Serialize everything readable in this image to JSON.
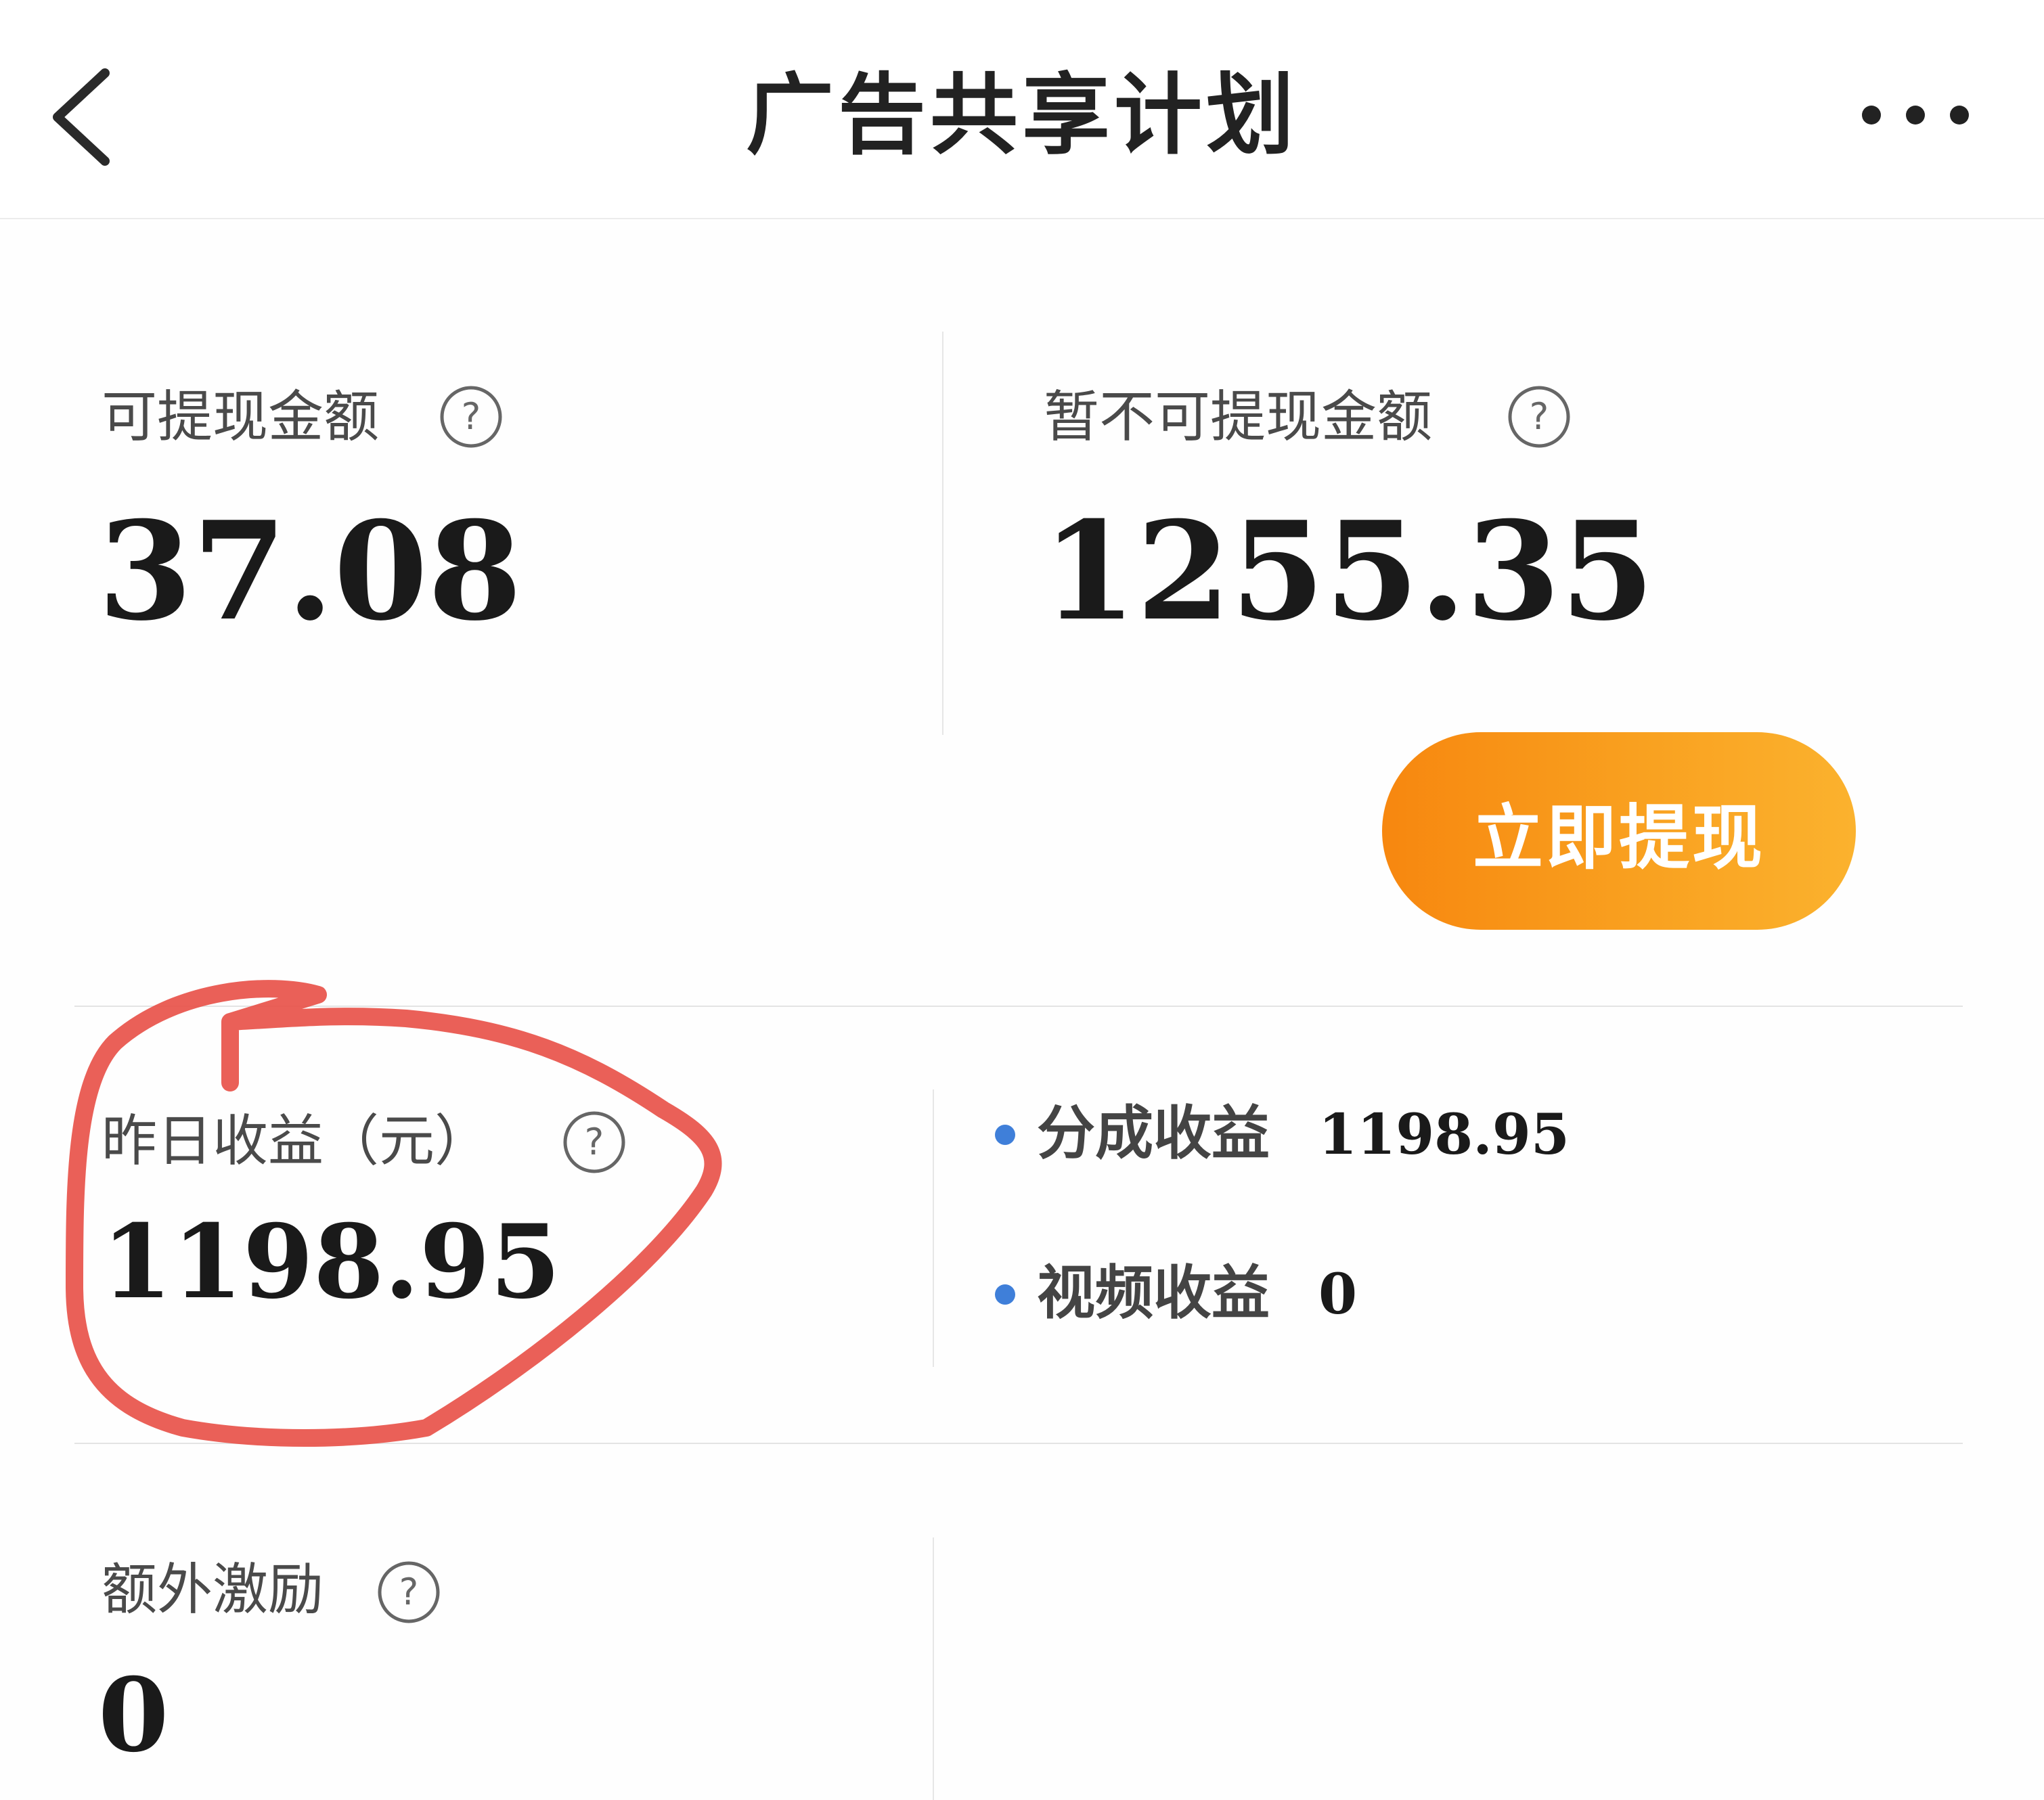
{
  "header": {
    "title": "广告共享计划",
    "back_icon": "chevron-left-icon",
    "more_icon": "more-dots-icon"
  },
  "balances": {
    "withdrawable_label": "可提现金额",
    "withdrawable_value": "37.08",
    "pending_label": "暂不可提现金额",
    "pending_value": "1255.35",
    "withdraw_button": "立即提现"
  },
  "yesterday": {
    "label": "昨日收益（元）",
    "value": "1198.95",
    "breakdown": [
      {
        "label": "分成收益",
        "value": "1198.95"
      },
      {
        "label": "视频收益",
        "value": "0"
      }
    ]
  },
  "extra": {
    "label": "额外激励",
    "value": "0"
  },
  "colors": {
    "accent_orange": "#f7870f",
    "accent_orange_light": "#fbb22e",
    "bullet_blue": "#3f7fd9",
    "annotation_red": "#e8534a"
  }
}
